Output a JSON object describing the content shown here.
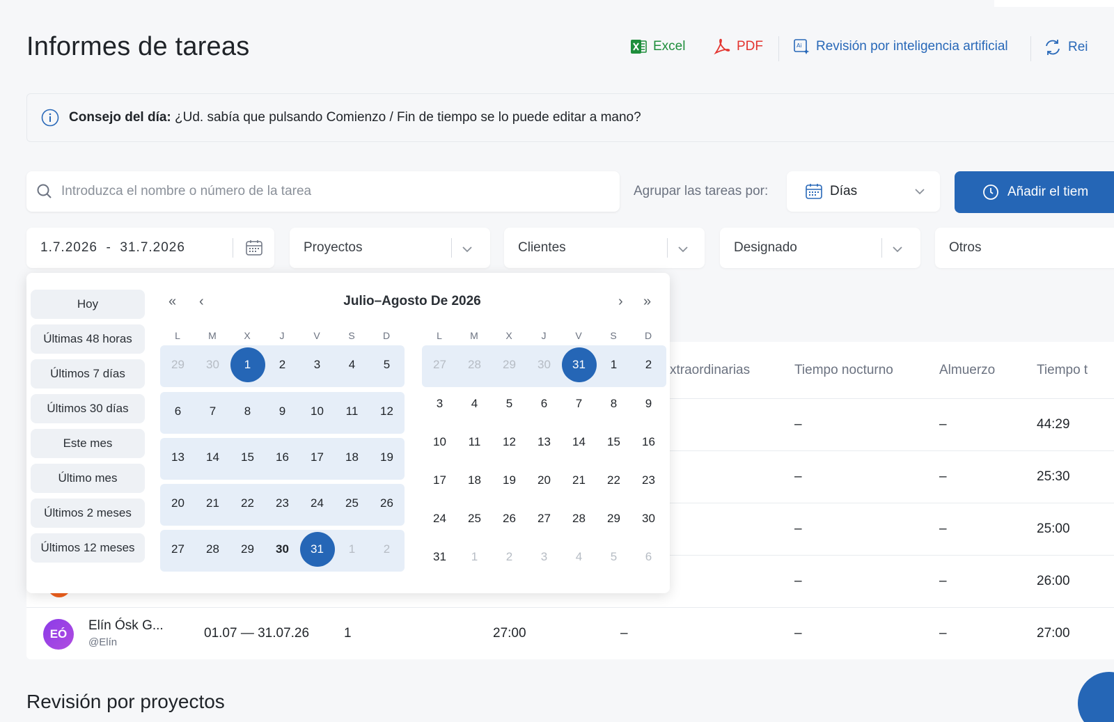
{
  "header": {
    "title": "Informes de tareas",
    "actions": {
      "excel": "Excel",
      "pdf": "PDF",
      "ai_review": "Revisión por inteligencia artificial",
      "reset": "Rei"
    }
  },
  "tip": {
    "label": "Consejo del día:",
    "text": "¿Ud. sabía que pulsando Comienzo / Fin de tiempo se lo puede editar a mano?"
  },
  "search": {
    "placeholder": "Introduzca el nombre o número de la tarea"
  },
  "grouping": {
    "label": "Agrupar las tareas por:",
    "value": "Días"
  },
  "add_button": "Añadir el tiem",
  "filters": {
    "date_range": "1.7.2026  -  31.7.2026",
    "projects": "Proyectos",
    "clients": "Clientes",
    "assigned": "Designado",
    "others": "Otros"
  },
  "table": {
    "headers": {
      "overtime": "xtraordinarias",
      "night": "Tiempo nocturno",
      "lunch": "Almuerzo",
      "total": "Tiempo t"
    },
    "rows": [
      {
        "night": "–",
        "lunch": "–",
        "total": "44:29"
      },
      {
        "night": "–",
        "lunch": "–",
        "total": "25:30"
      },
      {
        "night": "–",
        "lunch": "–",
        "total": "25:00"
      },
      {
        "night": "–",
        "lunch": "–",
        "total": "26:00"
      }
    ],
    "last_row": {
      "initials": "EÓ",
      "name": "Elín Ósk G...",
      "handle": "@Elín",
      "period": "01.07 — 31.07.26",
      "count": "1",
      "time": "27:00",
      "overtime": "–",
      "night": "–",
      "lunch": "–",
      "total": "27:00"
    }
  },
  "section": {
    "title": "Revisión por proyectos"
  },
  "picker": {
    "presets": [
      "Hoy",
      "Últimas 48 horas",
      "Últimos 7 días",
      "Últimos 30 días",
      "Este mes",
      "Último mes",
      "Últimos 2 meses",
      "Últimos 12 meses"
    ],
    "title": "Julio–Agosto De 2026",
    "weekdays": [
      "L",
      "M",
      "X",
      "J",
      "V",
      "S",
      "D"
    ],
    "nav": {
      "prev_year": "«",
      "prev": "‹",
      "next": "›",
      "next_year": "»"
    },
    "months": [
      {
        "weeks": [
          [
            "29",
            "30",
            "1",
            "2",
            "3",
            "4",
            "5"
          ],
          [
            "6",
            "7",
            "8",
            "9",
            "10",
            "11",
            "12"
          ],
          [
            "13",
            "14",
            "15",
            "16",
            "17",
            "18",
            "19"
          ],
          [
            "20",
            "21",
            "22",
            "23",
            "24",
            "25",
            "26"
          ],
          [
            "27",
            "28",
            "29",
            "30",
            "31",
            "1",
            "2"
          ]
        ]
      },
      {
        "weeks": [
          [
            "27",
            "28",
            "29",
            "30",
            "31",
            "1",
            "2"
          ],
          [
            "3",
            "4",
            "5",
            "6",
            "7",
            "8",
            "9"
          ],
          [
            "10",
            "11",
            "12",
            "13",
            "14",
            "15",
            "16"
          ],
          [
            "17",
            "18",
            "19",
            "20",
            "21",
            "22",
            "23"
          ],
          [
            "24",
            "25",
            "26",
            "27",
            "28",
            "29",
            "30"
          ],
          [
            "31",
            "1",
            "2",
            "3",
            "4",
            "5",
            "6"
          ]
        ]
      }
    ]
  },
  "colors": {
    "accent": "#2566b6",
    "range_bg": "#e6eef8",
    "excel": "#1f8e3c",
    "pdf": "#e3342f"
  }
}
